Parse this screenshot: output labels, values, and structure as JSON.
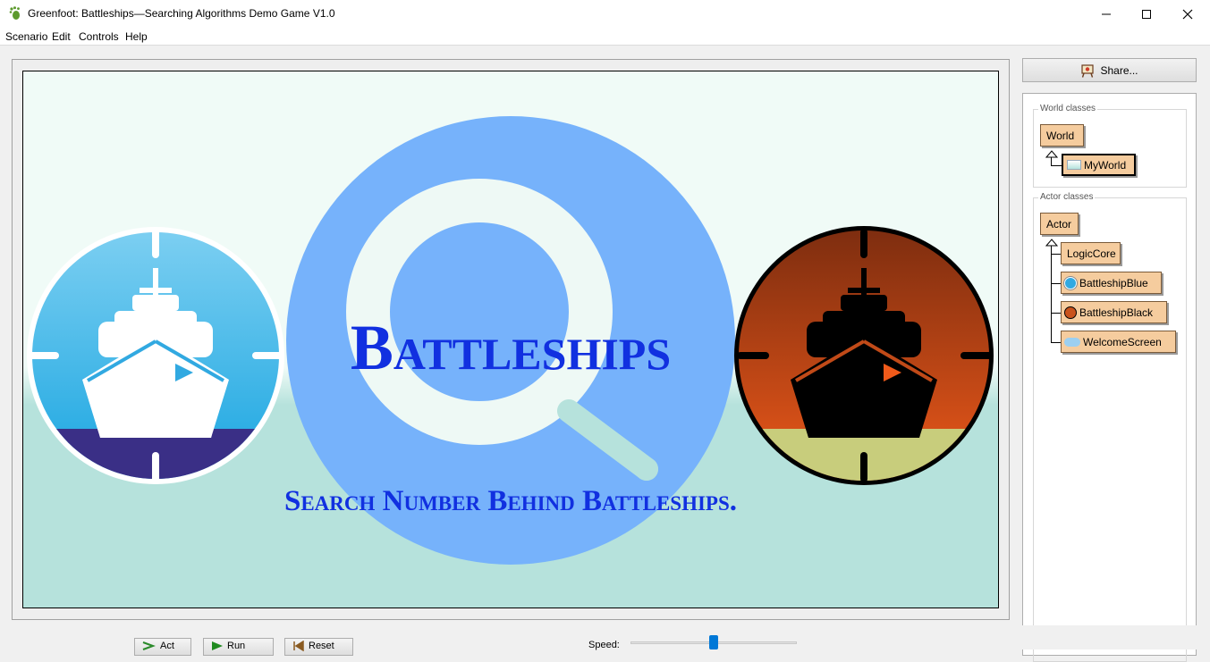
{
  "window": {
    "title": "Greenfoot: Battleships—Searching Algorithms Demo Game V1.0",
    "icon": "greenfoot-footprint-icon"
  },
  "menu": {
    "items": [
      "Scenario",
      "Edit",
      "Controls",
      "Help"
    ]
  },
  "world": {
    "title": "Battleships",
    "subtitle": "Search Number Behind Battleships.",
    "colors": {
      "title": "#1130e0",
      "magnifier": "#76b2fb",
      "background_top": "#f0fbf7",
      "background_bottom": "#b6e2dc",
      "blue_badge": "#31a9e1",
      "blue_sea": "#3a2f86",
      "black_badge_top": "#7b2c0f",
      "black_badge_bottom": "#f05a1a",
      "black_sand": "#c8cd7c"
    }
  },
  "sidebar": {
    "share_label": "Share...",
    "share_icon": "easel-share-icon",
    "world_group_label": "World classes",
    "actor_group_label": "Actor classes",
    "world_classes": [
      "World",
      "MyWorld"
    ],
    "actor_classes": [
      "Actor",
      "LogicCore",
      "BattleshipBlue",
      "BattleshipBlack",
      "WelcomeScreen"
    ],
    "selected_class": "MyWorld"
  },
  "controls": {
    "act_label": "Act",
    "run_label": "Run",
    "reset_label": "Reset",
    "speed_label": "Speed:",
    "speed_value": 0.5
  }
}
